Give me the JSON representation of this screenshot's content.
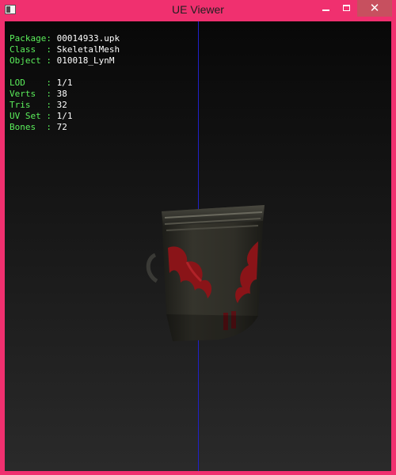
{
  "window": {
    "title": "UE Viewer",
    "controls": {
      "minimize": "minimize",
      "maximize": "maximize",
      "close": "✕"
    }
  },
  "info": {
    "rows1": [
      {
        "label": "Package:",
        "value": "00014933.upk"
      },
      {
        "label": "Class  :",
        "value": "SkeletalMesh"
      },
      {
        "label": "Object :",
        "value": "010018_LynM"
      }
    ],
    "rows2": [
      {
        "label": "LOD    :",
        "value": "1/1"
      },
      {
        "label": "Verts  :",
        "value": "38"
      },
      {
        "label": "Tris   :",
        "value": "32"
      },
      {
        "label": "UV Set :",
        "value": "1/1"
      },
      {
        "label": "Bones  :",
        "value": "72"
      }
    ]
  },
  "colors": {
    "titlebar": "#f0306f",
    "label": "#5bef5b",
    "value": "#ffffff",
    "axis": "#2020c8",
    "mesh_dark": "#2b2a24",
    "mesh_accent": "#8a1418"
  }
}
